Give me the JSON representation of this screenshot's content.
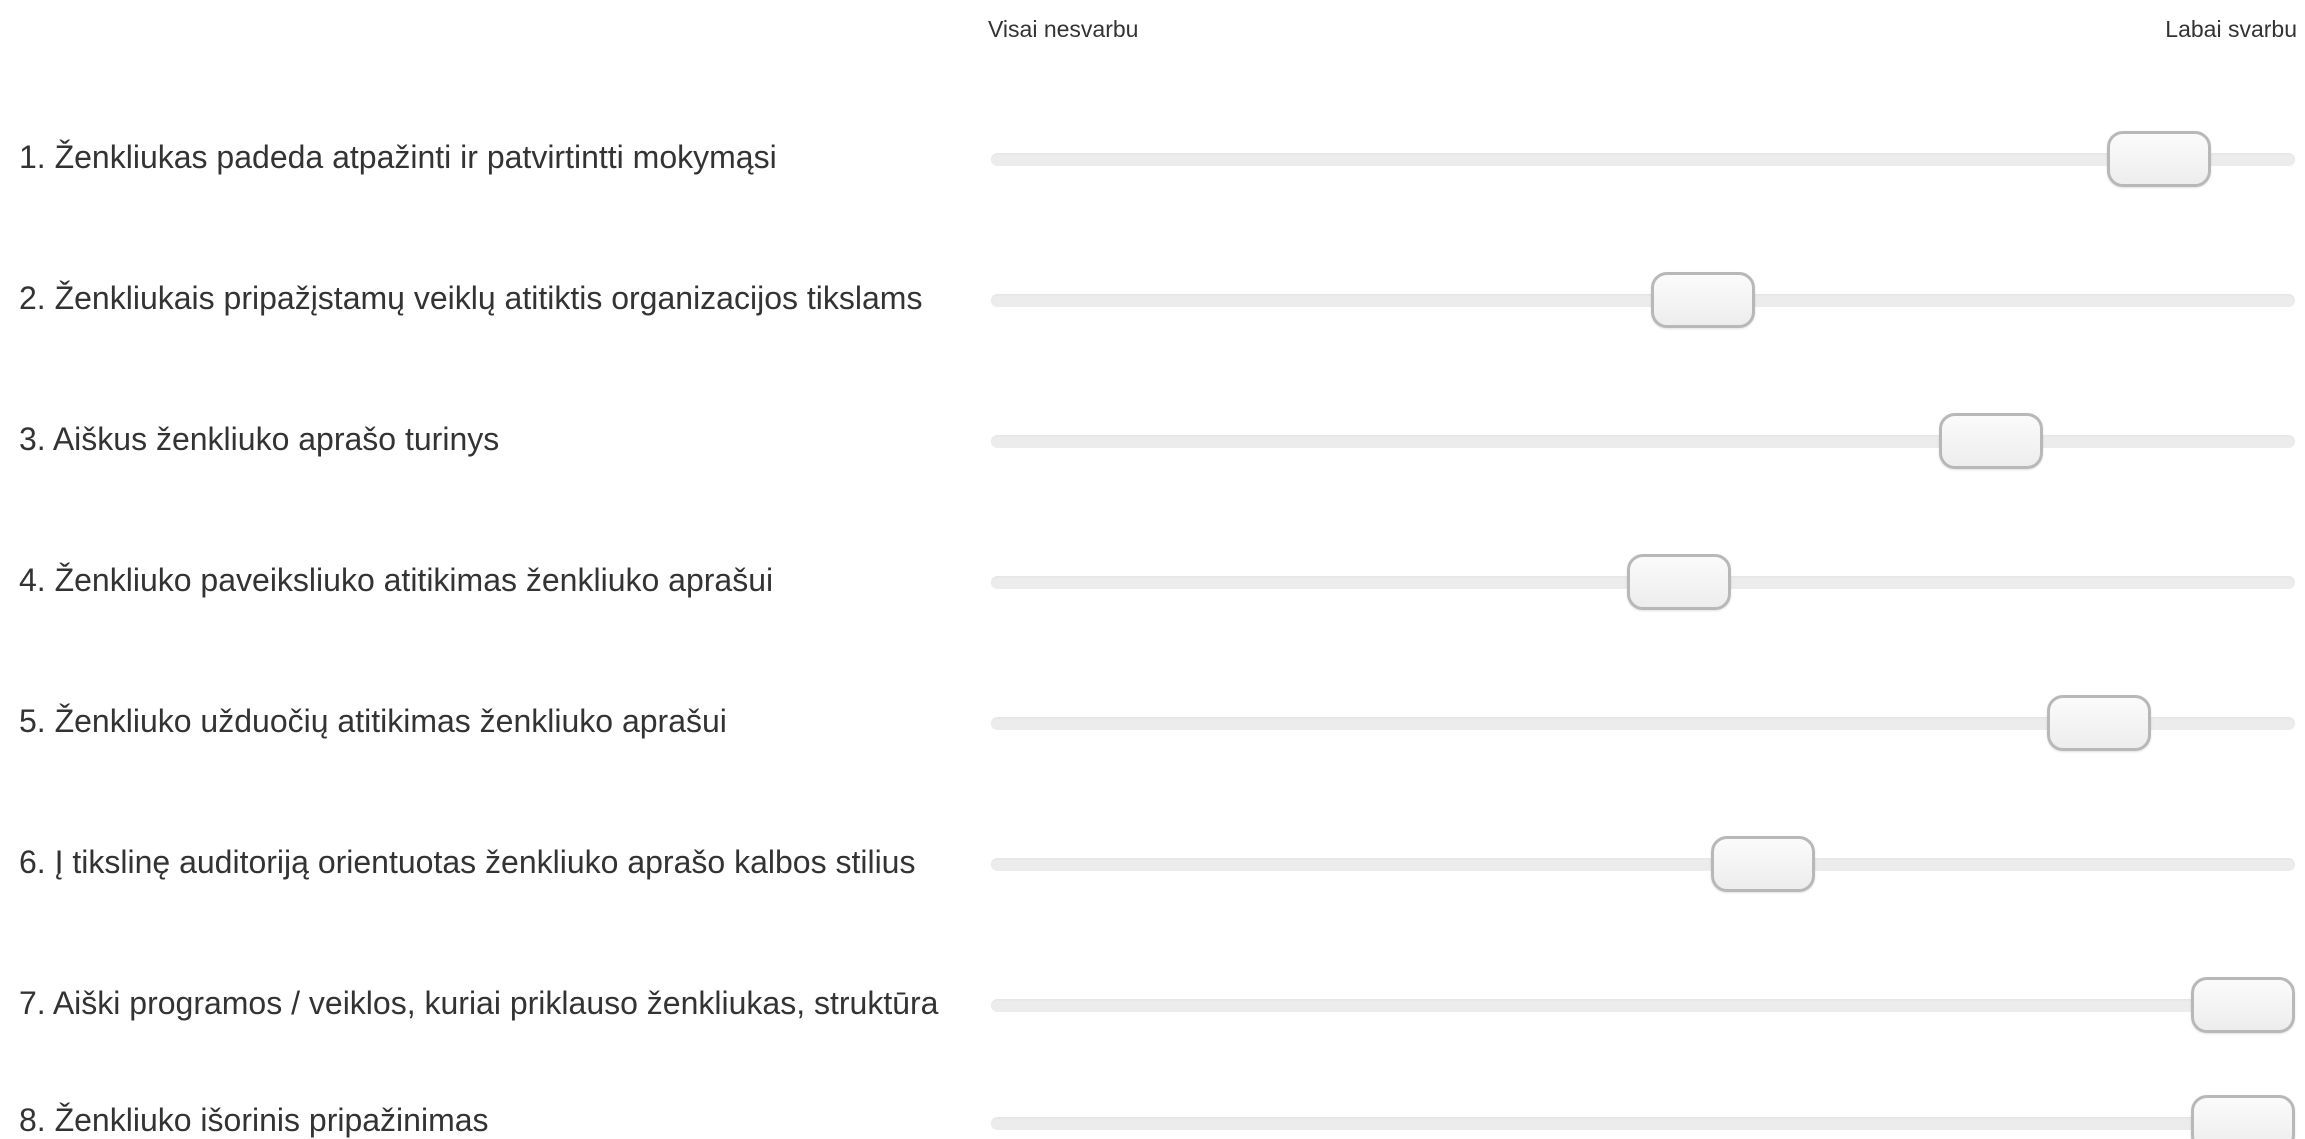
{
  "scale": {
    "min_label": "Visai nesvarbu",
    "max_label": "Labai svarbu"
  },
  "items": [
    {
      "label": "1. Ženkliukas padeda atpažinti ir patvirtintti mokymąsi",
      "value": 0.93
    },
    {
      "label": "2. Ženkliukais pripažįstamų veiklų atitiktis organizacijos tikslams",
      "value": 0.55
    },
    {
      "label": "3. Aiškus ženkliuko aprašo turinys",
      "value": 0.79
    },
    {
      "label": "4. Ženkliuko paveiksliuko atitikimas ženkliuko aprašui",
      "value": 0.53
    },
    {
      "label": "5. Ženkliuko užduočių atitikimas ženkliuko aprašui",
      "value": 0.88
    },
    {
      "label": "6. Į tikslinę auditoriją orientuotas ženkliuko aprašo kalbos stilius",
      "value": 0.6
    },
    {
      "label": "7. Aiški programos / veiklos, kuriai priklauso ženkliukas, struktūra",
      "value": 1.0
    },
    {
      "label": "8. Ženkliuko išorinis pripažinimas",
      "value": 1.0
    }
  ]
}
